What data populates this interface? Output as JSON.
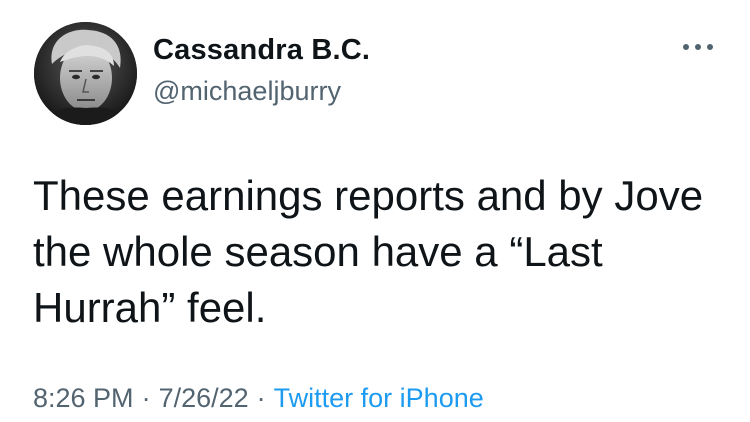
{
  "author": {
    "name": "Cassandra B.C.",
    "handle": "@michaeljburry"
  },
  "tweet": {
    "text": "These earnings reports and by Jove\nthe whole season have a “Last\nHurrah” feel."
  },
  "meta": {
    "time": "8:26 PM",
    "separator": "·",
    "date": "7/26/22",
    "source": "Twitter for iPhone"
  },
  "icons": {
    "avatar": "profile-photo",
    "more": "more-options-icon"
  },
  "colors": {
    "text": "#0f1419",
    "secondary": "#536471",
    "link": "#1d9bf0"
  }
}
